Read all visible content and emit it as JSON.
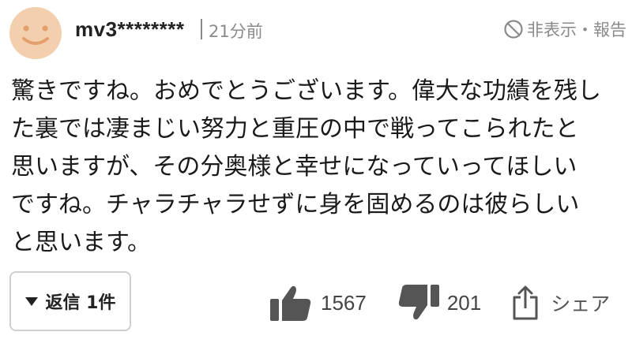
{
  "comment": {
    "username": "mv3********",
    "time": "21分前",
    "report_label": "非表示・報告",
    "lines": [
      "驚きですね。おめでとうございます。偉大な功績を残し",
      "た裏では凄まじい努力と重圧の中で戦ってこられたと",
      "思いますが、その分奥様と幸せになっていってほしい",
      "ですね。チャラチャラせずに身を固めるのは彼らしい",
      "と思います。"
    ],
    "reply_label": "返信 1件",
    "likes": "1567",
    "dislikes": "201",
    "share_label": "シェア"
  },
  "icons": {
    "avatar": "smiley-avatar",
    "report": "block-icon",
    "reply": "triangle-down-icon",
    "like": "thumbs-up-icon",
    "dislike": "thumbs-down-icon",
    "share": "share-icon"
  },
  "colors": {
    "avatar_bg": "#f3cfae",
    "avatar_features": "#e3a06e",
    "muted_text": "#8a8a8a",
    "icon_gray": "#555555"
  }
}
